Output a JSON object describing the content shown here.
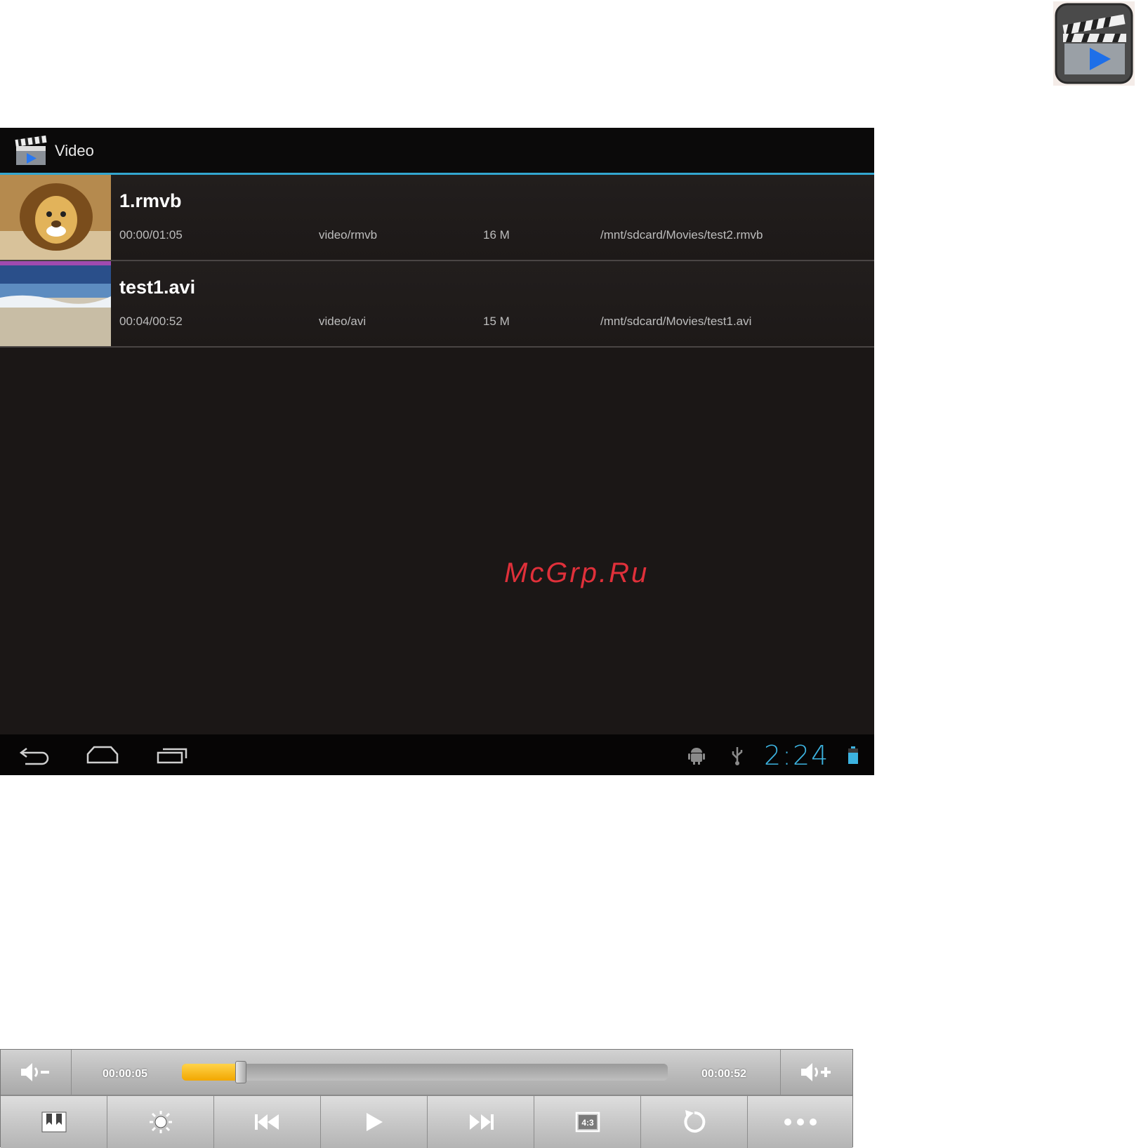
{
  "app_icon": "video-player-icon",
  "action_bar": {
    "title": "Video",
    "icon": "clapperboard-icon"
  },
  "files": [
    {
      "name": "1.rmvb",
      "progress": "00:00/01:05",
      "type": "video/rmvb",
      "size": "16 M",
      "path": "/mnt/sdcard/Movies/test2.rmvb"
    },
    {
      "name": "test1.avi",
      "progress": "00:04/00:52",
      "type": "video/avi",
      "size": "15 M",
      "path": "/mnt/sdcard/Movies/test1.avi"
    }
  ],
  "watermark": "McGrp.Ru",
  "status_bar": {
    "time": "2:24"
  },
  "colors": {
    "accent": "#33a6cf",
    "seek_fill": "#f5b000",
    "watermark": "#e0303a"
  },
  "player": {
    "elapsed": "00:00:05",
    "duration": "00:00:52",
    "seek_fraction": 0.12,
    "aspect_label": "4:3"
  }
}
